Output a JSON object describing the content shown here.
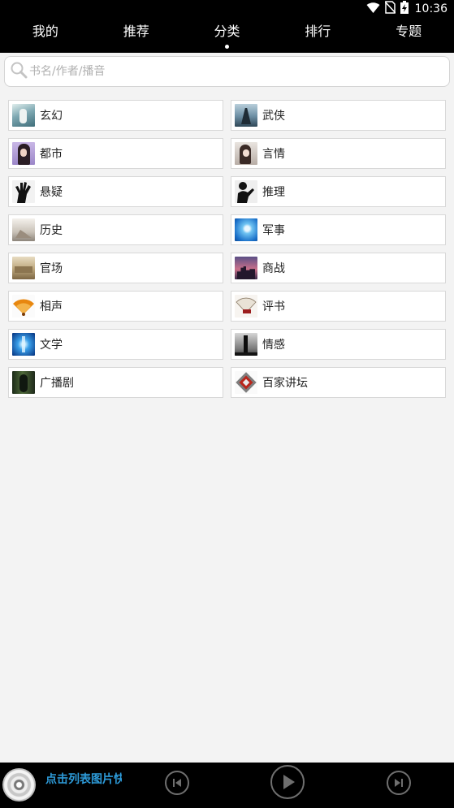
{
  "status_bar": {
    "time": "10:36"
  },
  "tabs": [
    {
      "label": "我的"
    },
    {
      "label": "推荐"
    },
    {
      "label": "分类",
      "active": true
    },
    {
      "label": "排行"
    },
    {
      "label": "专题"
    }
  ],
  "search": {
    "placeholder": "书名/作者/播音",
    "value": ""
  },
  "categories": [
    {
      "label": "玄幻",
      "icon": "fantasy-thumbnail"
    },
    {
      "label": "武侠",
      "icon": "martial-arts-thumbnail"
    },
    {
      "label": "都市",
      "icon": "urban-thumbnail"
    },
    {
      "label": "言情",
      "icon": "romance-thumbnail"
    },
    {
      "label": "悬疑",
      "icon": "suspense-thumbnail"
    },
    {
      "label": "推理",
      "icon": "mystery-thumbnail"
    },
    {
      "label": "历史",
      "icon": "history-thumbnail"
    },
    {
      "label": "军事",
      "icon": "military-thumbnail"
    },
    {
      "label": "官场",
      "icon": "officialdom-thumbnail"
    },
    {
      "label": "商战",
      "icon": "business-thumbnail"
    },
    {
      "label": "相声",
      "icon": "crosstalk-thumbnail"
    },
    {
      "label": "评书",
      "icon": "storytelling-thumbnail"
    },
    {
      "label": "文学",
      "icon": "literature-thumbnail"
    },
    {
      "label": "情感",
      "icon": "emotion-thumbnail"
    },
    {
      "label": "广播剧",
      "icon": "radio-drama-thumbnail"
    },
    {
      "label": "百家讲坛",
      "icon": "lecture-thumbnail"
    }
  ],
  "player": {
    "now_playing": "点击列表图片快",
    "icons": [
      "disc-icon",
      "previous-icon",
      "play-icon",
      "next-icon"
    ]
  },
  "colors": {
    "bar_background": "#000000",
    "page_background": "#f3f3f3",
    "now_playing_text": "#2d9ad8"
  }
}
